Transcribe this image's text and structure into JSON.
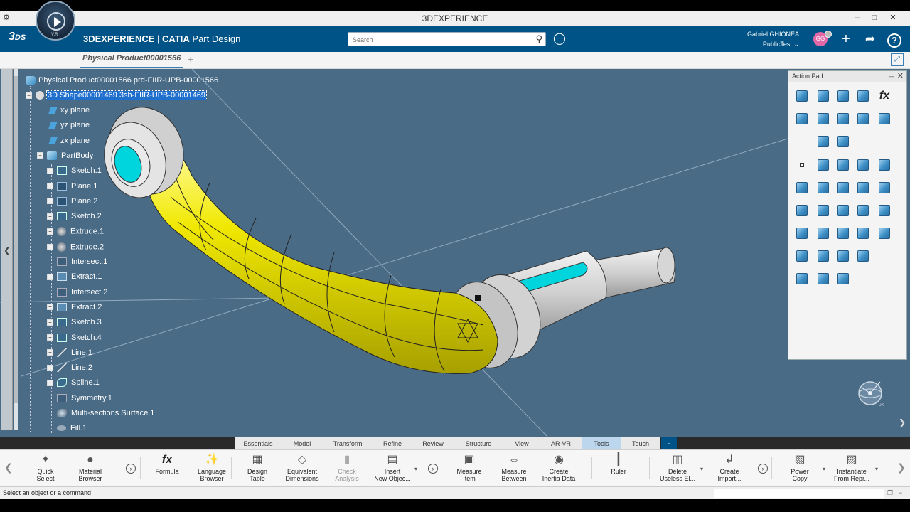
{
  "window": {
    "title": "3DEXPERIENCE",
    "minimize": "–",
    "restore": "□",
    "close": "✕"
  },
  "header": {
    "brand": "3DEXPERIENCE",
    "separator": " | ",
    "app_bold": "CATIA",
    "app_rest": " Part Design",
    "compass_label": "V.R",
    "search_placeholder": "Search",
    "user_name": "Gabriel GHIONEA",
    "user_context": "PublicTest",
    "avatar_initials": "GG"
  },
  "tabs": {
    "active": "Physical Product00001566",
    "add": "+"
  },
  "tree": {
    "root": "Physical Product00001566 prd-FIIR-UPB-00001566",
    "shape": "3D Shape00001469 3sh-FIIR-UPB-00001469",
    "items": [
      {
        "label": "xy plane",
        "icon": "plane-icon"
      },
      {
        "label": "yz plane",
        "icon": "plane-icon"
      },
      {
        "label": "zx plane",
        "icon": "plane-icon"
      },
      {
        "label": "PartBody",
        "icon": "body-icon"
      },
      {
        "label": "Sketch.1",
        "icon": "sketch-icon"
      },
      {
        "label": "Plane.1",
        "icon": "plane-feature-icon"
      },
      {
        "label": "Plane.2",
        "icon": "plane-feature-icon"
      },
      {
        "label": "Sketch.2",
        "icon": "sketch-icon"
      },
      {
        "label": "Extrude.1",
        "icon": "extrude-icon"
      },
      {
        "label": "Extrude.2",
        "icon": "extrude-icon"
      },
      {
        "label": "Intersect.1",
        "icon": "intersect-icon"
      },
      {
        "label": "Extract.1",
        "icon": "extract-icon"
      },
      {
        "label": "Intersect.2",
        "icon": "intersect-icon"
      },
      {
        "label": "Extract.2",
        "icon": "extract-icon"
      },
      {
        "label": "Sketch.3",
        "icon": "sketch-icon"
      },
      {
        "label": "Sketch.4",
        "icon": "sketch-icon"
      },
      {
        "label": "Line.1",
        "icon": "line-icon"
      },
      {
        "label": "Line.2",
        "icon": "line-icon"
      },
      {
        "label": "Spline.1",
        "icon": "spline-icon"
      },
      {
        "label": "Symmetry.1",
        "icon": "symmetry-icon"
      },
      {
        "label": "Multi-sections Surface.1",
        "icon": "multisection-icon"
      },
      {
        "label": "Fill.1",
        "icon": "fill-icon"
      }
    ]
  },
  "action_pad": {
    "title": "Action Pad",
    "minimize": "_",
    "close": "✕",
    "formula_glyph": "fx"
  },
  "workshop_tabs": [
    "Essentials",
    "Model",
    "Transform",
    "Refine",
    "Review",
    "Structure",
    "View",
    "AR-VR",
    "Tools",
    "Touch"
  ],
  "workshop_active": "Tools",
  "action_bar": [
    {
      "label1": "Quick",
      "label2": "Select",
      "icon": "✦",
      "name": "quick-select"
    },
    {
      "label1": "Material",
      "label2": "Browser",
      "icon": "●",
      "name": "material-browser"
    },
    {
      "label1": "Formula",
      "label2": "",
      "icon": "fx",
      "name": "formula"
    },
    {
      "label1": "Language",
      "label2": "Browser",
      "icon": "✨",
      "name": "language-browser"
    },
    {
      "label1": "Design",
      "label2": "Table",
      "icon": "▦",
      "name": "design-table"
    },
    {
      "label1": "Equivalent",
      "label2": "Dimensions",
      "icon": "◇",
      "name": "equivalent-dimensions"
    },
    {
      "label1": "Check",
      "label2": "Analysis",
      "icon": "▮",
      "name": "check-analysis"
    },
    {
      "label1": "Insert",
      "label2": "New Objec...",
      "icon": "▤",
      "name": "insert-new-object"
    },
    {
      "label1": "Measure",
      "label2": "Item",
      "icon": "▣",
      "name": "measure-item"
    },
    {
      "label1": "Measure",
      "label2": "Between",
      "icon": "⇔",
      "name": "measure-between"
    },
    {
      "label1": "Create",
      "label2": "Inertia Data",
      "icon": "◉",
      "name": "create-inertia-data"
    },
    {
      "label1": "Ruler",
      "label2": "",
      "icon": "┃",
      "name": "ruler"
    },
    {
      "label1": "Delete",
      "label2": "Useless El...",
      "icon": "▥",
      "name": "delete-useless-elements"
    },
    {
      "label1": "Create",
      "label2": "Import...",
      "icon": "↲",
      "name": "create-import"
    },
    {
      "label1": "Power",
      "label2": "Copy",
      "icon": "▧",
      "name": "power-copy"
    },
    {
      "label1": "Instantiate",
      "label2": "From Repr...",
      "icon": "▨",
      "name": "instantiate-from-repr"
    }
  ],
  "status": {
    "message": "Select an object or a command"
  },
  "colors": {
    "header": "#005386",
    "viewport": "#4a6b86",
    "part_yellow": "#e8e000",
    "part_gray": "#c8c8c8",
    "part_cyan": "#00d4dc",
    "selection": "#1f6fcf"
  }
}
